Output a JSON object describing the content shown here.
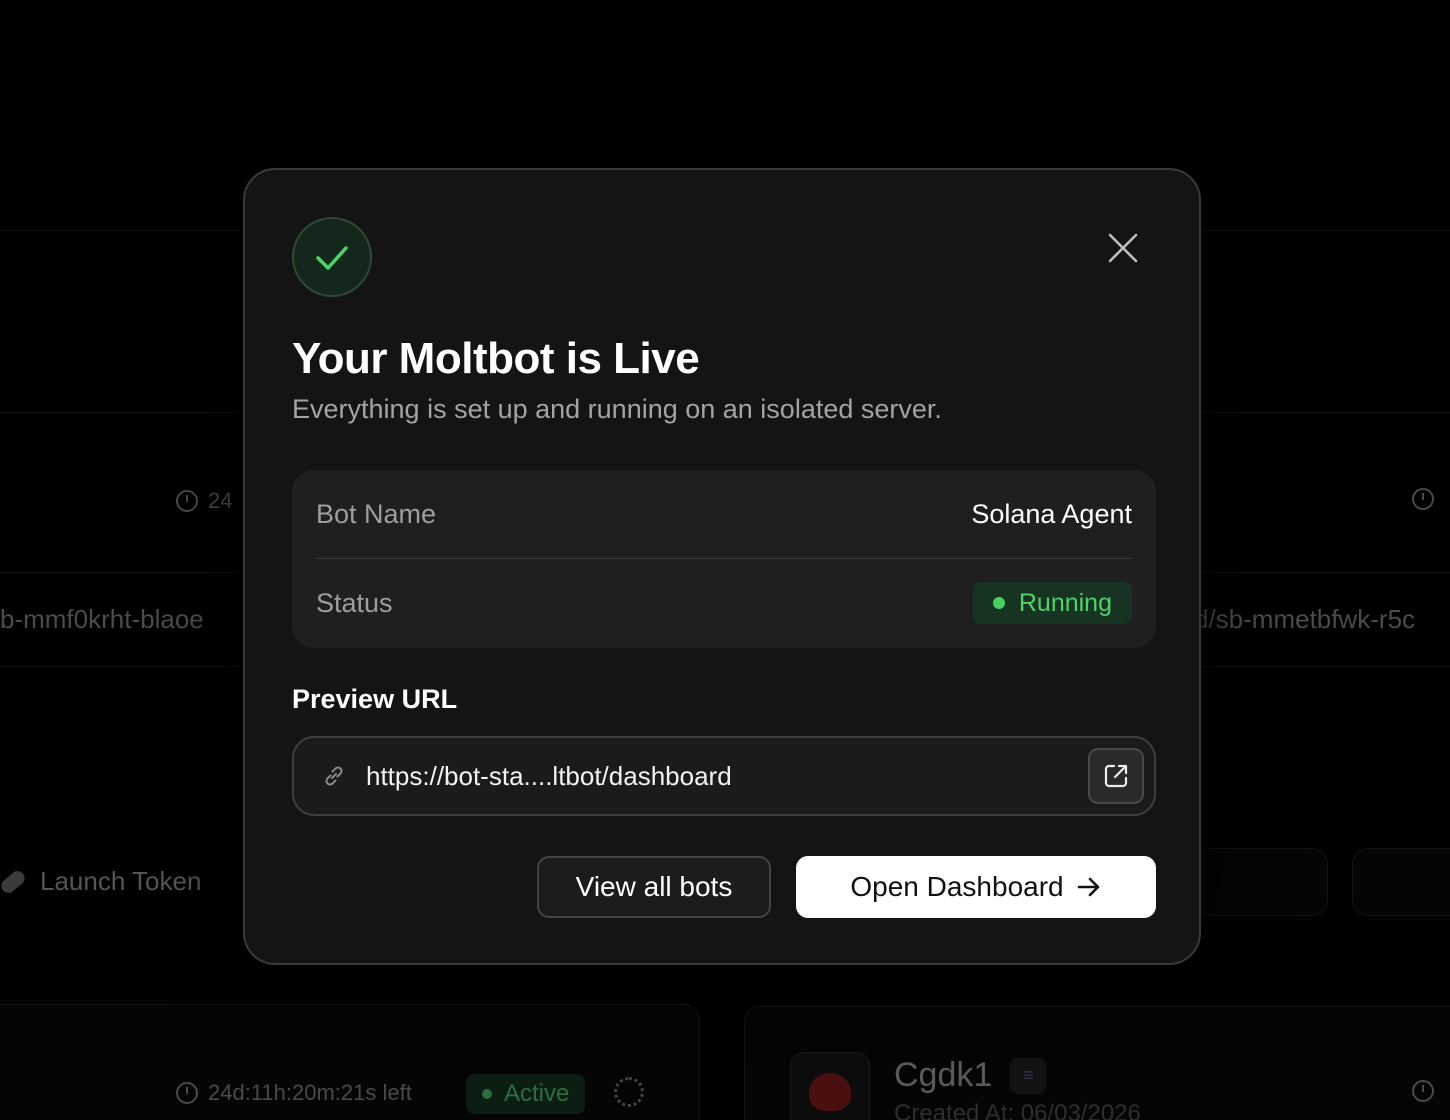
{
  "modal": {
    "title": "Your Moltbot is Live",
    "subtitle": "Everything is set up and running on an isolated server.",
    "info": {
      "bot_name_label": "Bot Name",
      "bot_name_value": "Solana Agent",
      "status_label": "Status",
      "status_value": "Running"
    },
    "preview": {
      "label": "Preview URL",
      "url": "https://bot-sta....ltbot/dashboard"
    },
    "buttons": {
      "view_all": "View all bots",
      "open_dashboard": "Open Dashboard"
    },
    "colors": {
      "success": "#4fd26b",
      "surface": "#141414"
    }
  },
  "background": {
    "timer_left": "24",
    "url_left": "b-mmf0krht-blaoe",
    "url_right": "d/sb-mmetbfwk-r5c",
    "launch_token": "Launch Token",
    "timer_bottom": "24d:11h:20m:21s left",
    "active_badge": "Active",
    "card_name": "Cgdk1",
    "card_created": "Created At: 06/03/2026"
  },
  "icons": {
    "success": "check-icon",
    "close": "close-icon",
    "link": "link-icon",
    "external": "external-link-icon",
    "arrow": "arrow-right-icon"
  }
}
